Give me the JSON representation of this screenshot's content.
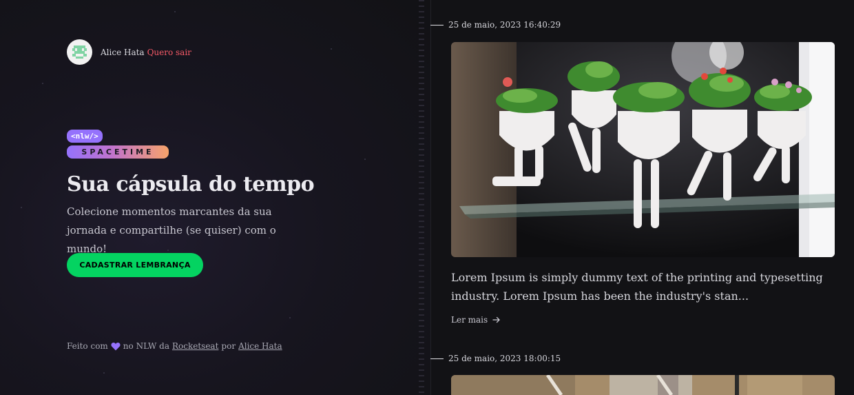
{
  "profile": {
    "name": "Alice Hata",
    "logout_label": "Quero sair"
  },
  "logo": {
    "top": "<nlw/>",
    "bottom": "SPACETIME"
  },
  "hero": {
    "title": "Sua cápsula do tempo",
    "subtitle": "Colecione momentos marcantes da sua jornada e compartilhe (se quiser) com o mundo!",
    "cta_label": "CADASTRAR LEMBRANÇA"
  },
  "footer": {
    "made_with": "Feito com",
    "middle": "no NLW da",
    "rocketseat": "Rocketseat",
    "by": "por",
    "author": "Alice Hata"
  },
  "memories": [
    {
      "date": "25 de maio, 2023 16:40:29",
      "excerpt": "Lorem Ipsum is simply dummy text of the printing and typesetting industry. Lorem Ipsum has been the industry's stan...",
      "read_more": "Ler mais"
    },
    {
      "date": "25 de maio, 2023 18:00:15"
    }
  ],
  "colors": {
    "accent_green": "#04d361",
    "logout_red": "#f75a68",
    "purple": "#9572fc",
    "background": "#121215"
  }
}
